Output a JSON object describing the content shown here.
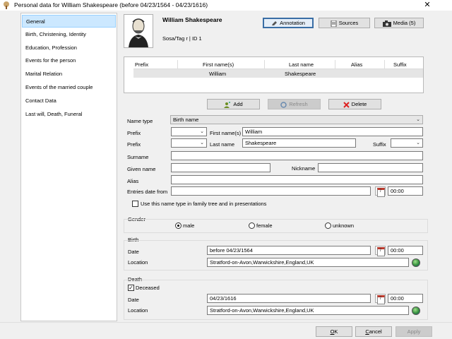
{
  "window": {
    "title": "Personal data for William Shakespeare (before 04/23/1564 - 04/23/1616)",
    "close_glyph": "✕",
    "icon": "tree-icon"
  },
  "sidebar": {
    "items": [
      {
        "label": "General",
        "active": true
      },
      {
        "label": "Birth, Christening, Identity"
      },
      {
        "label": "Education, Profession"
      },
      {
        "label": "Events for the person"
      },
      {
        "label": "Marital Relation"
      },
      {
        "label": "Events of the married couple"
      },
      {
        "label": "Contact Data"
      },
      {
        "label": "Last will, Death, Funeral"
      }
    ]
  },
  "person": {
    "name": "William Shakespeare",
    "sosa": "Sosa/Tag r | ID 1"
  },
  "toolbar": {
    "annotation": "Annotation",
    "sources": "Sources",
    "media": "Media (5)"
  },
  "names_table": {
    "headers": [
      "Prefix",
      "First name(s)",
      "Last name",
      "Alias",
      "Suffix"
    ],
    "rows": [
      {
        "prefix": "",
        "first": "William",
        "last": "Shakespeare",
        "alias": "",
        "suffix": ""
      }
    ]
  },
  "actions": {
    "add": "Add",
    "refresh": "Refresh",
    "delete": "Delete"
  },
  "form": {
    "name_type_label": "Name type",
    "name_type_value": "Birth name",
    "prefix_label": "Prefix",
    "first_names_label": "First name(s)",
    "first_names_value": "William",
    "last_name_label": "Last name",
    "last_name_value": "Shakespeare",
    "suffix_label": "Suffix",
    "surname_label": "Surname",
    "given_name_label": "Given name",
    "nickname_label": "Nickname",
    "alias_label": "Alias",
    "entries_date_label": "Entries date from",
    "entries_time": "00:00",
    "use_name_type_label": "Use this name type in family tree and in presentations"
  },
  "gender": {
    "label": "Gender",
    "options": [
      "male",
      "female",
      "unknown"
    ],
    "selected": "male"
  },
  "birth": {
    "label": "Birth",
    "date_label": "Date",
    "date_value": "before 04/23/1564",
    "time": "00:00",
    "location_label": "Location",
    "location_value": "Stratford-on-Avon,Warwickshire,England,UK"
  },
  "death": {
    "label": "Death",
    "deceased_label": "Deceased",
    "deceased_checked": true,
    "check_glyph": "✓",
    "date_label": "Date",
    "date_value": "04/23/1616",
    "time": "00:00",
    "location_label": "Location",
    "location_value": "Stratford-on-Avon,Warwickshire,England,UK"
  },
  "footer": {
    "ok_underlined": "O",
    "ok_rest": "K",
    "cancel_underlined": "C",
    "cancel_rest": "ancel",
    "apply": "Apply"
  },
  "colors": {
    "selected_item": "#cce8ff",
    "selected_border": "#99d1ff"
  }
}
